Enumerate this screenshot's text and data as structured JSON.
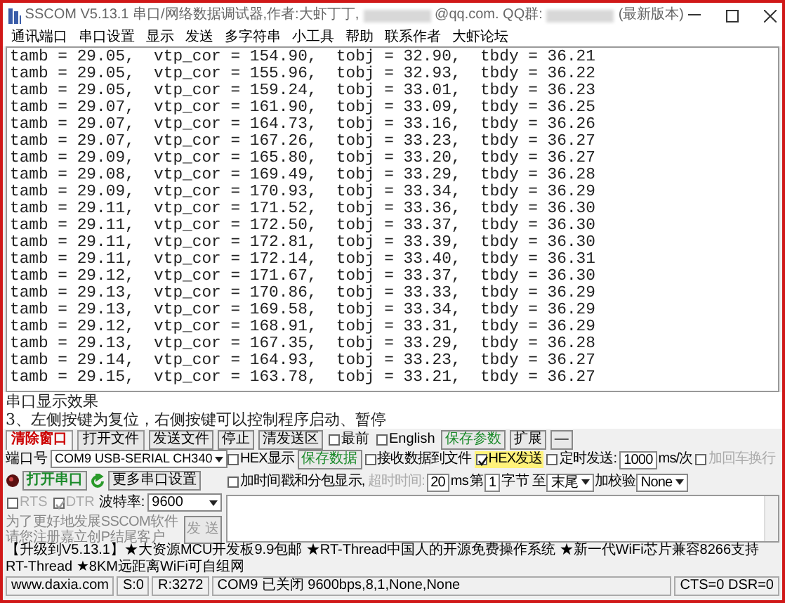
{
  "window": {
    "title": "SSCOM V5.13.1 串口/网络数据调试器,作者:大虾丁丁,",
    "title_email": "@qq.com. QQ群:",
    "title_suffix": "(最新版本)"
  },
  "menu": [
    "通讯端口",
    "串口设置",
    "显示",
    "发送",
    "多字符串",
    "小工具",
    "帮助",
    "联系作者",
    "大虾论坛"
  ],
  "log": {
    "lines": [
      "tamb = 29.05,  vtp_cor = 154.90,  tobj = 32.90,  tbdy = 36.21",
      "tamb = 29.05,  vtp_cor = 155.96,  tobj = 32.93,  tbdy = 36.22",
      "tamb = 29.05,  vtp_cor = 159.24,  tobj = 33.01,  tbdy = 36.23",
      "tamb = 29.07,  vtp_cor = 161.90,  tobj = 33.09,  tbdy = 36.25",
      "tamb = 29.07,  vtp_cor = 164.73,  tobj = 33.16,  tbdy = 36.26",
      "tamb = 29.07,  vtp_cor = 167.26,  tobj = 33.23,  tbdy = 36.27",
      "tamb = 29.09,  vtp_cor = 165.80,  tobj = 33.20,  tbdy = 36.27",
      "tamb = 29.08,  vtp_cor = 169.49,  tobj = 33.29,  tbdy = 36.28",
      "tamb = 29.09,  vtp_cor = 170.93,  tobj = 33.34,  tbdy = 36.29",
      "tamb = 29.11,  vtp_cor = 171.52,  tobj = 33.36,  tbdy = 36.30",
      "tamb = 29.11,  vtp_cor = 172.50,  tobj = 33.37,  tbdy = 36.30",
      "tamb = 29.11,  vtp_cor = 172.81,  tobj = 33.39,  tbdy = 36.30",
      "tamb = 29.11,  vtp_cor = 172.14,  tobj = 33.40,  tbdy = 36.31",
      "tamb = 29.12,  vtp_cor = 171.67,  tobj = 33.37,  tbdy = 36.30",
      "tamb = 29.13,  vtp_cor = 170.86,  tobj = 33.33,  tbdy = 36.29",
      "tamb = 29.13,  vtp_cor = 169.58,  tobj = 33.34,  tbdy = 36.29",
      "tamb = 29.12,  vtp_cor = 168.91,  tobj = 33.31,  tbdy = 36.29",
      "tamb = 29.13,  vtp_cor = 167.35,  tobj = 33.29,  tbdy = 36.28",
      "tamb = 29.14,  vtp_cor = 164.93,  tobj = 33.23,  tbdy = 36.27",
      "tamb = 29.15,  vtp_cor = 163.78,  tobj = 33.21,  tbdy = 36.27"
    ]
  },
  "caption": [
    "串口显示效果",
    "3、左侧按键为复位，右侧按键可以控制程序启动、暂停"
  ],
  "toolbar": [
    {
      "kind": "tab",
      "label": "清除窗口",
      "selected": true
    },
    {
      "kind": "tab",
      "label": "打开文件",
      "selected": false
    },
    {
      "kind": "button",
      "label": "发送文件"
    },
    {
      "kind": "button",
      "label": "停止"
    },
    {
      "kind": "button",
      "label": "清发送区"
    },
    {
      "kind": "checkbox",
      "label": "最前",
      "checked": false
    },
    {
      "kind": "checkbox",
      "label": "English",
      "checked": false
    },
    {
      "kind": "green_button",
      "label": "保存参数"
    },
    {
      "kind": "button",
      "label": "扩展"
    },
    {
      "kind": "button",
      "label": "—"
    }
  ],
  "port": {
    "label": "端口号",
    "value": "COM9 USB-SERIAL CH340"
  },
  "open_button": "打开串口",
  "more_button": "更多串口设置",
  "rts": {
    "label": "RTS",
    "checked": false
  },
  "dtr": {
    "label": "DTR",
    "checked": true
  },
  "baud": {
    "label": "波特率:",
    "value": "9600"
  },
  "promo": [
    "为了更好地发展SSCOM软件",
    "请您注册嘉立创P结尾客户"
  ],
  "send_button": "发 送",
  "option_rows": [
    [
      {
        "kind": "checkbox",
        "label": "HEX显示",
        "checked": false,
        "disabled": false
      },
      {
        "kind": "green_button",
        "label": "保存数据",
        "disabled": false
      },
      {
        "kind": "checkbox",
        "label": "接收数据到文件",
        "checked": false,
        "disabled": false
      },
      {
        "kind": "checkbox",
        "label": "HEX发送",
        "checked": true,
        "disabled": false
      },
      {
        "kind": "checkbox",
        "label": "定时发送:",
        "checked": false,
        "disabled": false
      },
      {
        "kind": "input",
        "value": "1000",
        "disabled": false
      },
      {
        "kind": "label",
        "label": "ms/次",
        "disabled": false
      },
      {
        "kind": "checkbox",
        "label": "加回车换行",
        "checked": false,
        "disabled": true
      }
    ],
    [
      {
        "kind": "checkbox",
        "label": "加时间戳和分包显示,",
        "checked": false,
        "disabled": false
      },
      {
        "kind": "label",
        "label": "超时时间:",
        "disabled": true
      },
      {
        "kind": "input",
        "value": "20",
        "disabled": false
      },
      {
        "kind": "label",
        "label": "ms",
        "disabled": false
      },
      {
        "kind": "label",
        "label": "第",
        "disabled": false
      },
      {
        "kind": "input",
        "value": "1",
        "disabled": false
      },
      {
        "kind": "label",
        "label": "字节 至",
        "disabled": false
      },
      {
        "kind": "select",
        "value": "末尾",
        "disabled": false
      },
      {
        "kind": "label",
        "label": "加校验",
        "disabled": false
      },
      {
        "kind": "select",
        "value": "None",
        "disabled": false
      }
    ]
  ],
  "ad": "【升级到V5.13.1】★大资源MCU开发板9.9包邮 ★RT-Thread中国人的开源免费操作系统 ★新一代WiFi芯片兼容8266支持RT-Thread ★8KM远距离WiFi可自组网",
  "status": [
    "www.daxia.com",
    "S:0",
    "R:3272",
    "COM9 已关闭  9600bps,8,1,None,None",
    "CTS=0 DSR=0"
  ]
}
